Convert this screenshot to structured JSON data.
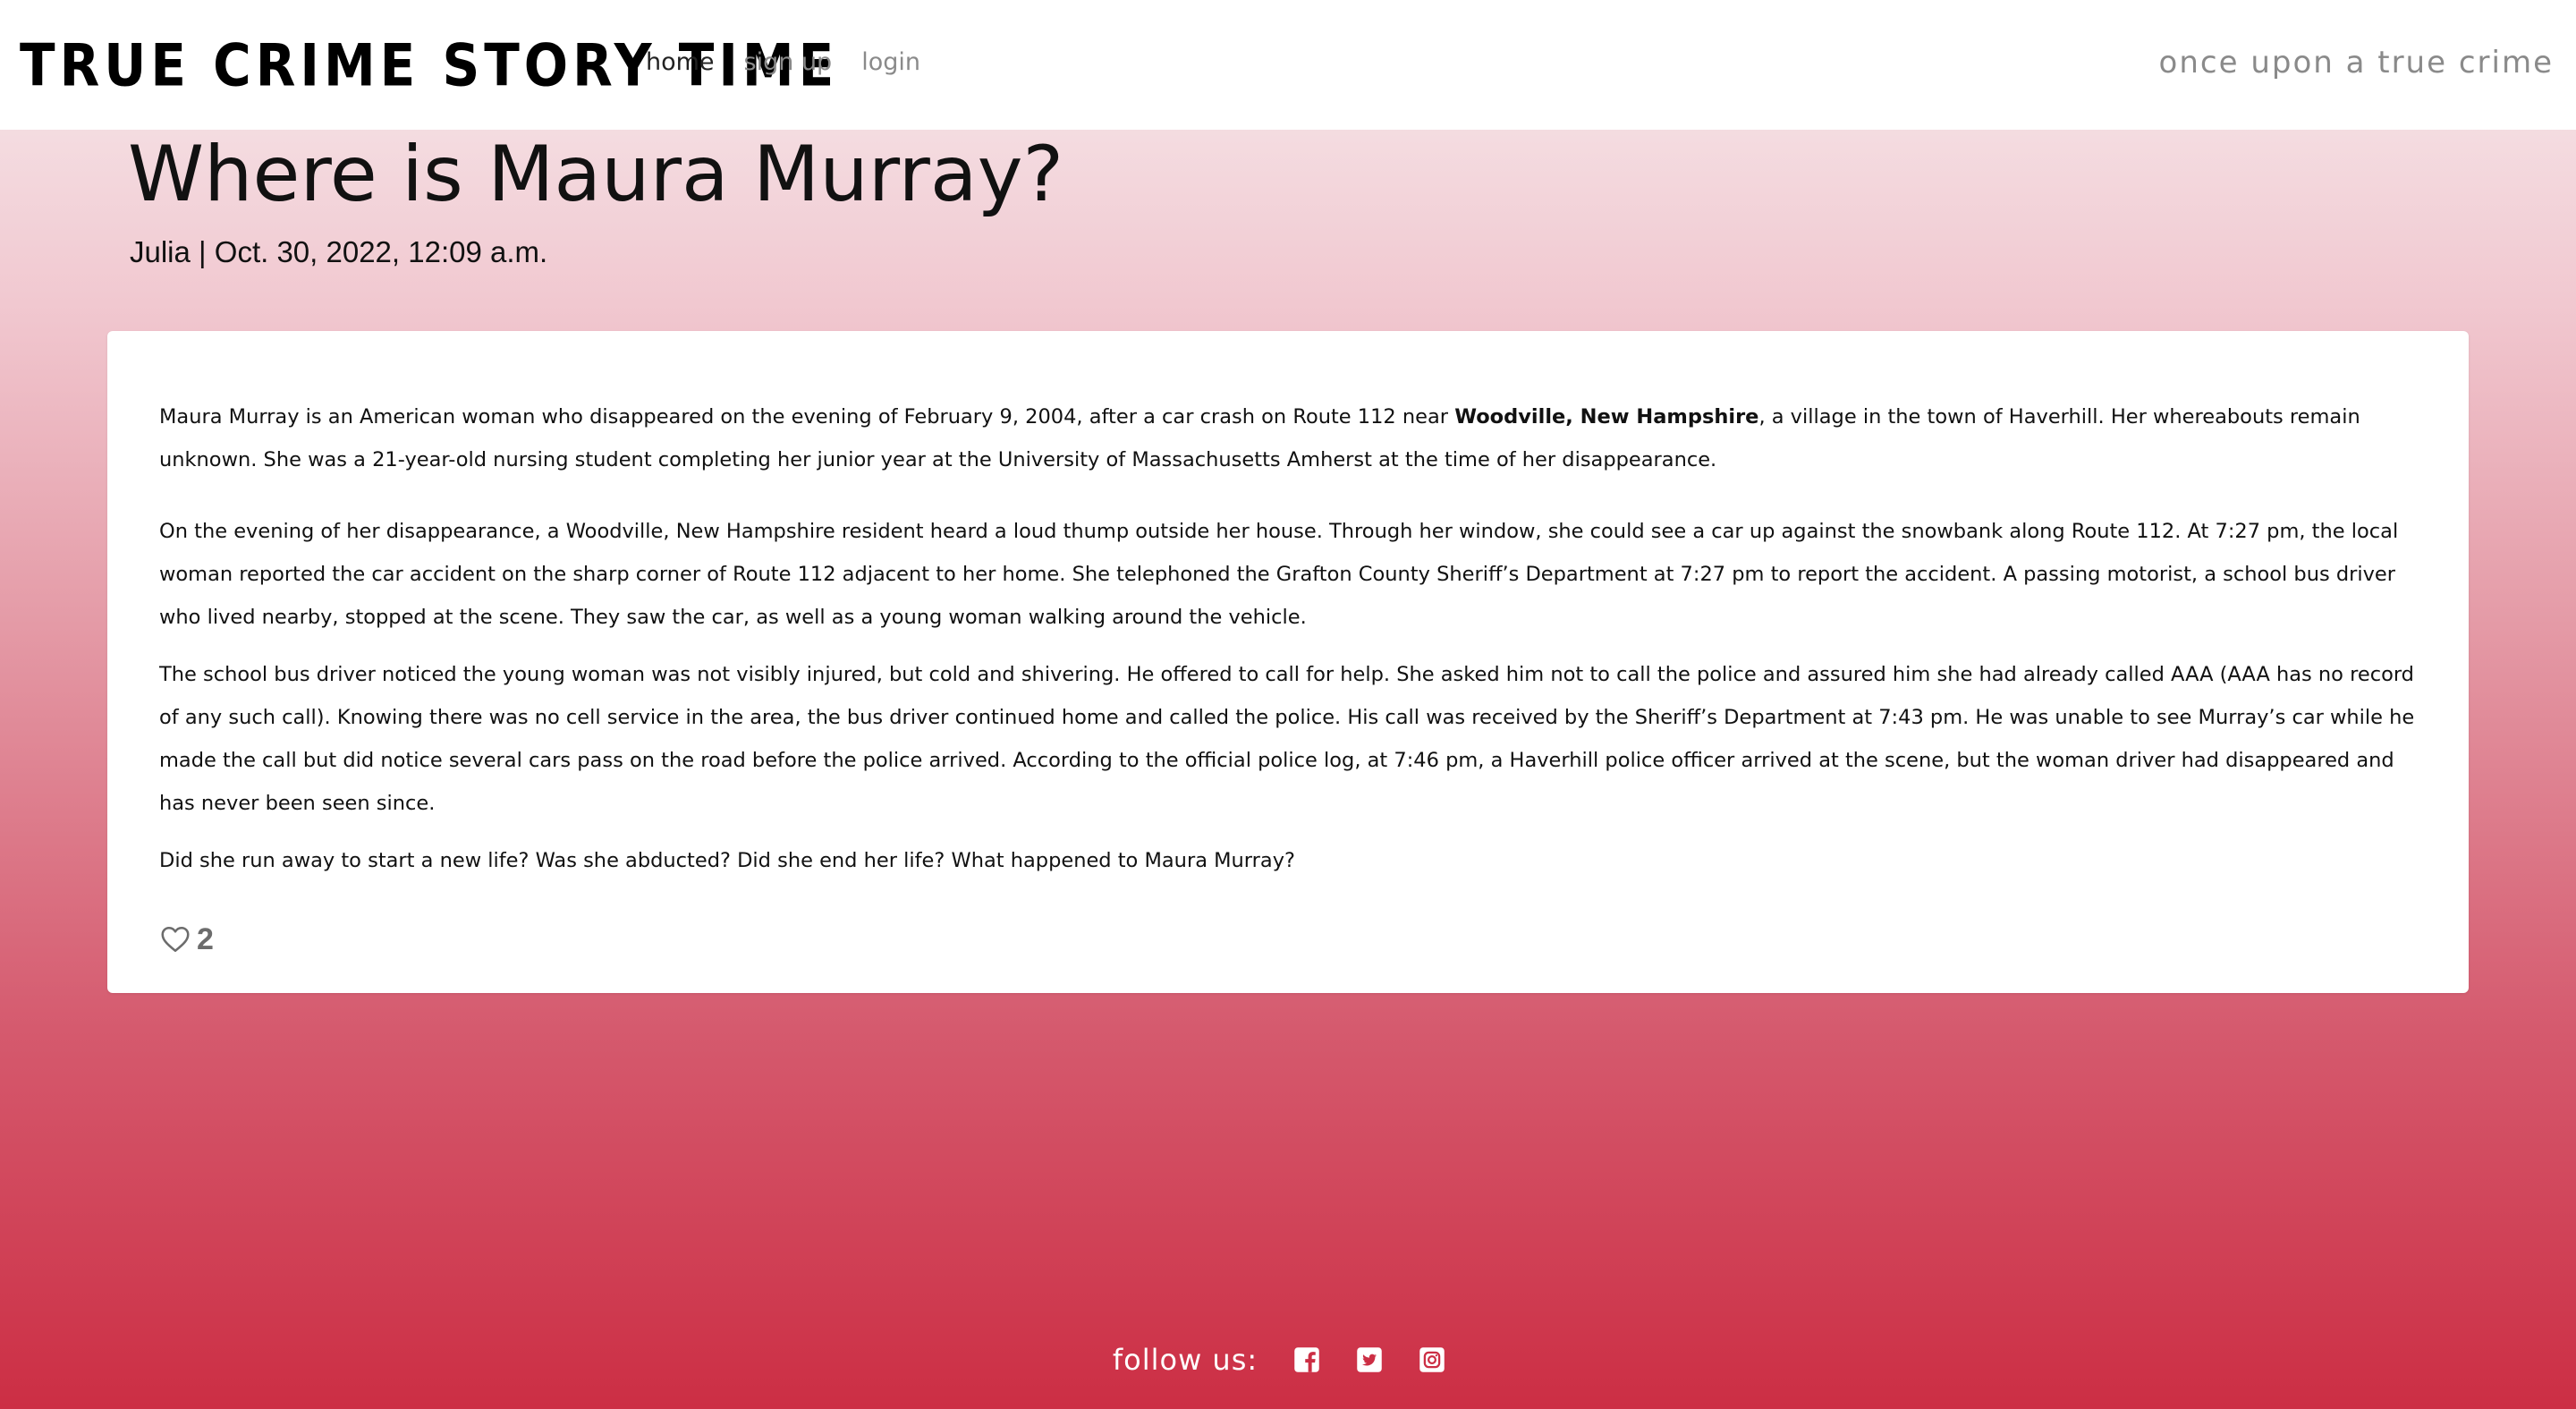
{
  "header": {
    "brand": "TRUE CRIME STORY TIME",
    "nav": [
      {
        "label": "home",
        "active": true
      },
      {
        "label": "sign up",
        "active": false
      },
      {
        "label": "login",
        "active": false
      }
    ],
    "tagline": "once upon a true crime"
  },
  "post": {
    "title": "Where is Maura Murray?",
    "meta": "Julia | Oct. 30, 2022, 12:09 a.m.",
    "p1_before": "Maura Murray is an American woman who disappeared on the evening of February 9, 2004, after a car crash on Route 112 near ",
    "p1_bold": "Woodville, New Hampshire",
    "p1_after": ", a village in the town of Haverhill. Her whereabouts remain unknown. She was a 21-year-old nursing student completing her junior year at the University of Massachusetts Amherst at the time of her disappearance.",
    "p2": "On the evening of her disappearance, a Woodville, New Hampshire resident heard a loud thump outside her house. Through her window, she could see a car up against the snowbank along Route 112.  At 7:27 pm, the local woman reported the car accident on the sharp corner of Route 112 adjacent to her home. She telephoned the Grafton County Sheriff’s Department at 7:27 pm to report the accident.  A passing motorist, a school bus driver who lived nearby, stopped at the scene. They saw the car, as well as a young woman walking around the vehicle.",
    "p3": "The school bus driver noticed the young woman was not visibly injured, but cold and shivering.  He offered to call for help. She asked him not to call the police and assured him she had already called AAA (AAA has no record of any such call).  Knowing there was no cell service in the area, the bus driver continued home and called the police. His call was received by the Sheriff’s Department at 7:43 pm.  He was unable to see Murray’s car while he made the call but did notice several cars pass on the road before the police arrived.  According to the official police log, at 7:46 pm, a Haverhill police officer arrived at the scene, but the woman driver had disappeared and has never been seen since.",
    "p4": "Did she run away to start a new life?  Was she abducted?  Did she end her life?  What happened to Maura Murray?",
    "likes": "2",
    "like_icon": "heart-outline-icon"
  },
  "footer": {
    "follow_label": "follow us:",
    "social": [
      {
        "icon": "facebook-icon"
      },
      {
        "icon": "twitter-icon"
      },
      {
        "icon": "instagram-icon"
      }
    ]
  },
  "colors": {
    "gradient_top": "#f6ebed",
    "gradient_bottom": "#cc2e44",
    "muted_text": "#8a8a8a",
    "card": "#ffffff"
  }
}
